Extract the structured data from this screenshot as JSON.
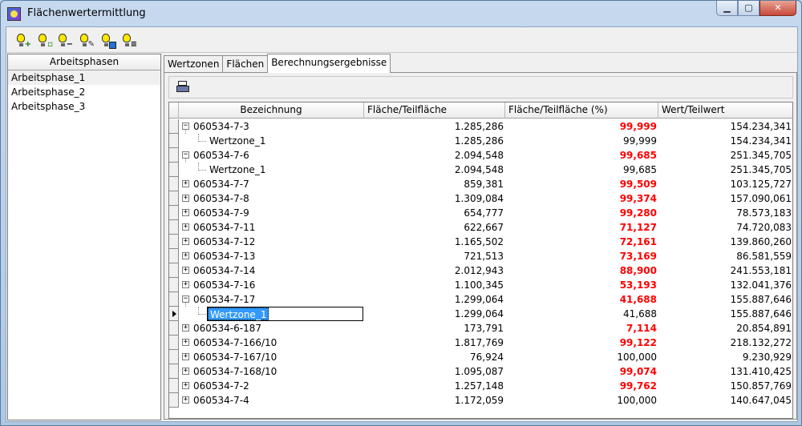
{
  "window": {
    "title": "Flächenwertermittlung"
  },
  "toolbar": {
    "buttons": [
      {
        "icon": "bulb-add-icon"
      },
      {
        "icon": "bulb-copy-icon"
      },
      {
        "icon": "bulb-remove-icon"
      },
      {
        "icon": "bulb-edit-icon"
      },
      {
        "icon": "bulb-table-icon"
      },
      {
        "icon": "bulb-calc-icon"
      }
    ]
  },
  "left_panel": {
    "header": "Arbeitsphasen",
    "items": [
      "Arbeitsphase_1",
      "Arbeitsphase_2",
      "Arbeitsphase_3"
    ],
    "selected_index": 0
  },
  "tabs": [
    {
      "label": "Wertzonen"
    },
    {
      "label": "Flächen"
    },
    {
      "label": "Berechnungsergebnisse",
      "active": true
    }
  ],
  "grid": {
    "columns": [
      "Bezeichnung",
      "Fläche/Teilfläche",
      "Fläche/Teilfläche (%)",
      "Wert/Teilwert"
    ],
    "rows": [
      {
        "level": 0,
        "expander": "−",
        "name": "060534-7-3",
        "area": "1.285,286",
        "pct": "99,999",
        "pct_red": true,
        "value": "154.234,341"
      },
      {
        "level": 1,
        "name": "Wertzone_1",
        "area": "1.285,286",
        "pct": "99,999",
        "pct_red": false,
        "value": "154.234,341"
      },
      {
        "level": 0,
        "expander": "−",
        "name": "060534-7-6",
        "area": "2.094,548",
        "pct": "99,685",
        "pct_red": true,
        "value": "251.345,705"
      },
      {
        "level": 1,
        "name": "Wertzone_1",
        "area": "2.094,548",
        "pct": "99,685",
        "pct_red": false,
        "value": "251.345,705"
      },
      {
        "level": 0,
        "expander": "+",
        "name": "060534-7-7",
        "area": "859,381",
        "pct": "99,509",
        "pct_red": true,
        "value": "103.125,727"
      },
      {
        "level": 0,
        "expander": "+",
        "name": "060534-7-8",
        "area": "1.309,084",
        "pct": "99,374",
        "pct_red": true,
        "value": "157.090,061"
      },
      {
        "level": 0,
        "expander": "+",
        "name": "060534-7-9",
        "area": "654,777",
        "pct": "99,280",
        "pct_red": true,
        "value": "78.573,183"
      },
      {
        "level": 0,
        "expander": "+",
        "name": "060534-7-11",
        "area": "622,667",
        "pct": "71,127",
        "pct_red": true,
        "value": "74.720,083"
      },
      {
        "level": 0,
        "expander": "+",
        "name": "060534-7-12",
        "area": "1.165,502",
        "pct": "72,161",
        "pct_red": true,
        "value": "139.860,260"
      },
      {
        "level": 0,
        "expander": "+",
        "name": "060534-7-13",
        "area": "721,513",
        "pct": "73,169",
        "pct_red": true,
        "value": "86.581,559"
      },
      {
        "level": 0,
        "expander": "+",
        "name": "060534-7-14",
        "area": "2.012,943",
        "pct": "88,900",
        "pct_red": true,
        "value": "241.553,181"
      },
      {
        "level": 0,
        "expander": "+",
        "name": "060534-7-16",
        "area": "1.100,345",
        "pct": "53,193",
        "pct_red": true,
        "value": "132.041,376"
      },
      {
        "level": 0,
        "expander": "−",
        "name": "060534-7-17",
        "area": "1.299,064",
        "pct": "41,688",
        "pct_red": true,
        "value": "155.887,646"
      },
      {
        "level": 1,
        "name": "Wertzone_1",
        "area": "1.299,064",
        "pct": "41,688",
        "pct_red": false,
        "value": "155.887,646",
        "current": true
      },
      {
        "level": 0,
        "expander": "+",
        "name": "060534-6-187",
        "area": "173,791",
        "pct": "7,114",
        "pct_red": true,
        "value": "20.854,891"
      },
      {
        "level": 0,
        "expander": "+",
        "name": "060534-7-166/10",
        "area": "1.817,769",
        "pct": "99,122",
        "pct_red": true,
        "value": "218.132,272"
      },
      {
        "level": 0,
        "expander": "+",
        "name": "060534-7-167/10",
        "area": "76,924",
        "pct": "100,000",
        "pct_red": false,
        "value": "9.230,929"
      },
      {
        "level": 0,
        "expander": "+",
        "name": "060534-7-168/10",
        "area": "1.095,087",
        "pct": "99,074",
        "pct_red": true,
        "value": "131.410,425"
      },
      {
        "level": 0,
        "expander": "+",
        "name": "060534-7-2",
        "area": "1.257,148",
        "pct": "99,762",
        "pct_red": true,
        "value": "150.857,769"
      },
      {
        "level": 0,
        "expander": "+",
        "name": "060534-7-4",
        "area": "1.172,059",
        "pct": "100,000",
        "pct_red": false,
        "value": "140.647,045"
      }
    ]
  },
  "colors": {
    "highlight": "#ff0000",
    "selection": "#3399ff"
  }
}
